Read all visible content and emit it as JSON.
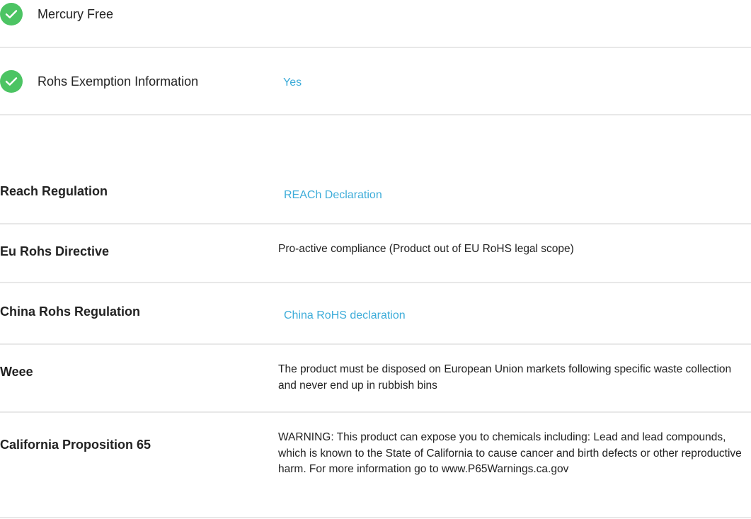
{
  "compliance_flags": [
    {
      "label": "Mercury Free",
      "value": "",
      "icon": "check-circle-icon",
      "icon_color": "#4cc463"
    },
    {
      "label": "Rohs Exemption Information",
      "value": "Yes",
      "icon": "check-circle-icon",
      "icon_color": "#4cc463"
    }
  ],
  "regulations": [
    {
      "label": "Reach Regulation",
      "value": "REACh Declaration",
      "is_link": true
    },
    {
      "label": "Eu Rohs Directive",
      "value": "Pro-active compliance (Product out of EU RoHS legal scope)",
      "is_link": false
    },
    {
      "label": "China Rohs Regulation",
      "value": "China RoHS declaration",
      "is_link": true
    },
    {
      "label": "Weee",
      "value": "The product must be disposed on European Union markets following specific waste collection and never end up in rubbish bins",
      "is_link": false
    },
    {
      "label": "California Proposition 65",
      "value": "WARNING: This product can expose you to chemicals including: Lead and lead compounds, which is known to the State of California to cause cancer and birth defects or other reproductive harm. For more information go to www.P65Warnings.ca.gov",
      "is_link": false
    }
  ],
  "colors": {
    "link": "#3dacd9",
    "check": "#4cc463",
    "divider": "#e8e8e8",
    "text": "#222222"
  }
}
